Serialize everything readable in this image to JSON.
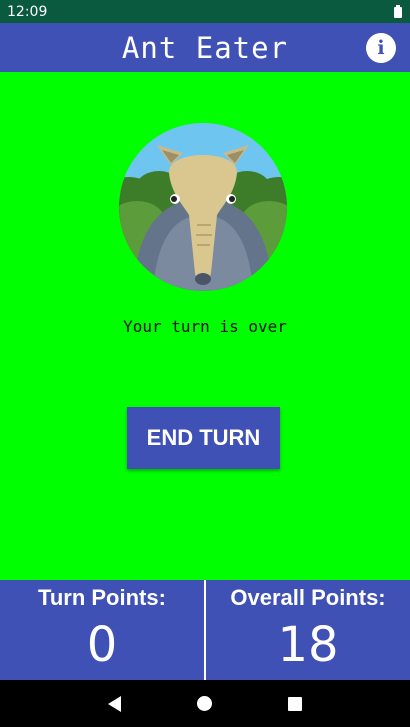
{
  "status_bar": {
    "time": "12:09",
    "battery_icon": "battery-full-icon"
  },
  "app_bar": {
    "title": "Ant Eater",
    "info_icon": "info-icon",
    "info_glyph": "i"
  },
  "main": {
    "avatar_icon": "anteater-avatar-icon",
    "message": "Your turn is over",
    "end_turn_label": "END TURN",
    "background": "#00ff00"
  },
  "scoreboard": {
    "turn_label": "Turn Points:",
    "turn_value": "0",
    "overall_label": "Overall Points:",
    "overall_value": "18"
  },
  "nav_bar": {
    "back_icon": "back-icon",
    "home_icon": "home-icon",
    "recents_icon": "recents-icon"
  },
  "colors": {
    "primary": "#3f51b5",
    "status_bar": "#0a5a3f",
    "content": "#00ff00"
  }
}
